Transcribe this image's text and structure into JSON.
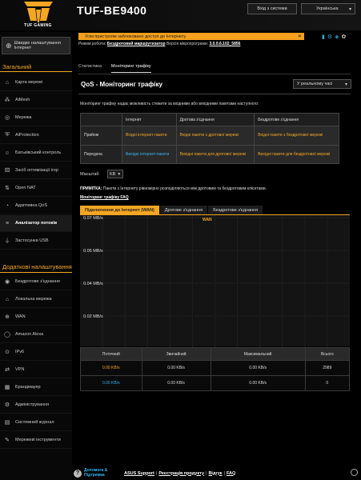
{
  "header": {
    "brand": "TUF GAMING",
    "model": "TUF-BE9400",
    "logout_label": "Вхід з системи",
    "language": "Українська"
  },
  "alert": {
    "text": "Усім пристроям заблоковано доступ до Інтернету."
  },
  "mode_line": {
    "prefix": "Режим роботи:",
    "mode": "Бездротовий маршрутизатор",
    "firmware_prefix": "Версія мікропрограми:",
    "firmware": "3.0.0.6.102_5856"
  },
  "sidebar": {
    "quick_setup": "Швидке налаштування Інтернет",
    "general_header": "Загальний",
    "advanced_header": "Додаткові налаштування",
    "general_items": [
      {
        "label": "Карта мережі",
        "icon": "network-map-icon"
      },
      {
        "label": "AiMesh",
        "icon": "aimesh-icon"
      },
      {
        "label": "Мережа",
        "icon": "network-icon"
      },
      {
        "label": "AiProtection",
        "icon": "shield-icon"
      },
      {
        "label": "Батьківський контроль",
        "icon": "parental-icon"
      },
      {
        "label": "Засіб оптимізації ігор",
        "icon": "gamepad-icon"
      },
      {
        "label": "Open NAT",
        "icon": "open-nat-icon"
      },
      {
        "label": "Адаптивна QoS",
        "icon": "qos-icon"
      },
      {
        "label": "Аналізатор потоків",
        "icon": "analyzer-icon"
      },
      {
        "label": "Застосунки USB",
        "icon": "usb-icon"
      }
    ],
    "advanced_items": [
      {
        "label": "Бездротове з'єднання",
        "icon": "wireless-icon"
      },
      {
        "label": "Локальна мережа",
        "icon": "lan-icon"
      },
      {
        "label": "WAN",
        "icon": "globe-icon"
      },
      {
        "label": "Amazon Alexa",
        "icon": "alexa-icon"
      },
      {
        "label": "IPv6",
        "icon": "ipv6-icon"
      },
      {
        "label": "VPN",
        "icon": "vpn-icon"
      },
      {
        "label": "Брандмауер",
        "icon": "firewall-icon"
      },
      {
        "label": "Адміністрування",
        "icon": "admin-icon"
      },
      {
        "label": "Системний журнал",
        "icon": "log-icon"
      },
      {
        "label": "Мережеві інструменти",
        "icon": "tools-icon"
      }
    ]
  },
  "tabs": [
    "Статистика",
    "Моніторинг трафіку"
  ],
  "page_title": "QoS - Моніторинг трафіку",
  "view_mode": "У реальному часі",
  "description": "Моніторинг трафіку надає можливість стежити за вхідними або вихідними пакетами наступного:",
  "color_table": {
    "headers": [
      "",
      "Інтернет",
      "Дротова з'єднання",
      "Бездротове з'єднання"
    ],
    "rows": [
      {
        "label": "Прийом",
        "cells": [
          "Вхідні інтернет-пакети",
          "Вхідні пакети з дротової мережі",
          "Вхідні пакети з бездротової мережі"
        ]
      },
      {
        "label": "Передача",
        "cells": [
          "Вихідні інтернет-пакети",
          "Вихідні пакети для дротової мережі",
          "Вихідні пакети для бездротової мережі"
        ]
      }
    ]
  },
  "units": {
    "label": "Масштаб",
    "value": "KB"
  },
  "note": {
    "prefix": "ПРИМІТКА:",
    "text": "Пакети з Інтернету рівномірно розподіляються між дротовим та бездротовим клієнтами."
  },
  "faq": "Моніторинг трафіку FAQ",
  "chart_tabs": [
    "Підключення до Інтернет (WAN)",
    "Дротове з'єднання",
    "Бездротове з'єднання"
  ],
  "chart_data": {
    "type": "line",
    "legend": "WAN",
    "y_ticks": [
      "0.07 MB/s",
      "0.05 MB/s",
      "0.04 MB/s",
      "0.02 MB/s"
    ],
    "series": [
      {
        "name": "WAN",
        "values": [],
        "color": "#f5a623"
      }
    ]
  },
  "stats": {
    "headers": [
      "Поточний",
      "Звичайний",
      "Максимальний",
      "Всього"
    ],
    "rows": [
      {
        "current": "0.00 KB/s",
        "average": "0.00 KB/s",
        "max": "0.00 KB/s",
        "total": "2989",
        "color": "#f5a623"
      },
      {
        "current": "0.00 KB/s",
        "average": "0.00 KB/s",
        "max": "0.00 KB/s",
        "total": "0",
        "color": "#35b3f0"
      }
    ]
  },
  "footer": {
    "help": "Допомога & Підтримка",
    "links": [
      "ASUS Support",
      "Реєстрація продукту",
      "Відгук",
      "FAQ"
    ]
  }
}
